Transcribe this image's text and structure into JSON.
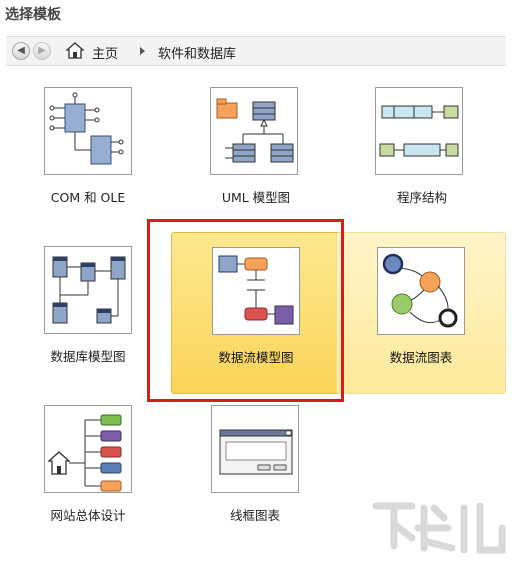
{
  "header": {
    "title": "选择模板"
  },
  "breadcrumb": {
    "home": "主页",
    "current": "软件和数据库"
  },
  "templates": [
    {
      "label": "COM 和 OLE"
    },
    {
      "label": "UML 模型图"
    },
    {
      "label": "程序结构"
    },
    {
      "label": "数据库模型图"
    },
    {
      "label": "数据流模型图"
    },
    {
      "label": "数据流图表"
    },
    {
      "label": "网站总体设计"
    },
    {
      "label": "线框图表"
    }
  ]
}
